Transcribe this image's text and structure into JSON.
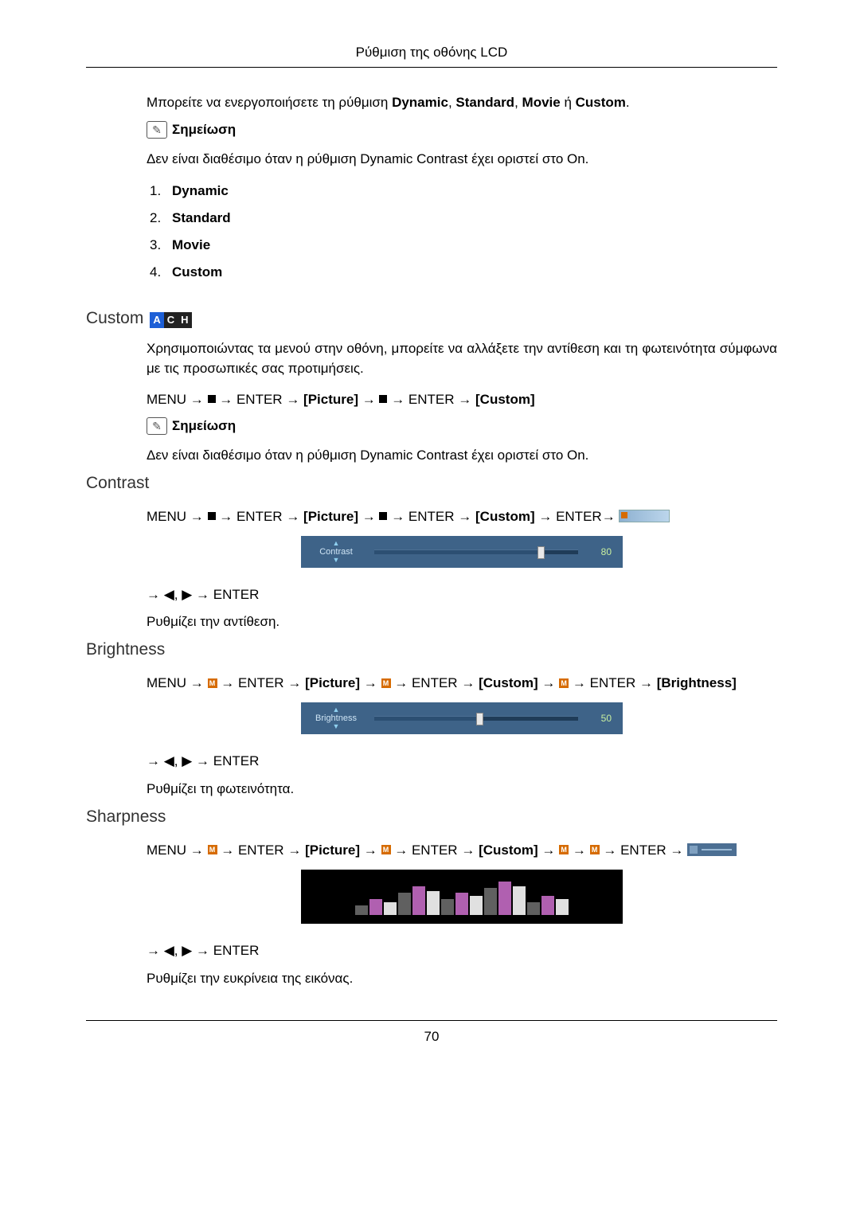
{
  "header": {
    "title": "Ρύθμιση της οθόνης LCD"
  },
  "intro": {
    "line": "Μπορείτε να ενεργοποιήσετε τη ρύθμιση ",
    "m1": "Dynamic",
    "m2": "Standard",
    "m3": "Movie",
    "m4": "Custom",
    "sep": ", ",
    "or": " ή ",
    "end": "."
  },
  "note_label": "Σημείωση",
  "note_body": "Δεν είναι διαθέσιμο όταν η ρύθμιση Dynamic Contrast έχει οριστεί στο On.",
  "modes": [
    {
      "n": "1.",
      "label": "Dynamic"
    },
    {
      "n": "2.",
      "label": "Standard"
    },
    {
      "n": "3.",
      "label": "Movie"
    },
    {
      "n": "4.",
      "label": "Custom"
    }
  ],
  "custom": {
    "heading": "Custom",
    "desc": "Χρησιμοποιώντας τα μενού στην οθόνη, μπορείτε να αλλάξετε την αντίθεση και τη φωτεινότητα σύμφωνα με τις προσωπικές σας προτιμήσεις.",
    "note_body": "Δεν είναι διαθέσιμο όταν η ρύθμιση Dynamic Contrast έχει οριστεί στο On."
  },
  "nav_tokens": {
    "menu": "MENU",
    "arrow": " → ",
    "enter": "ENTER",
    "picture": "[Picture]",
    "custom": "[Custom]",
    "brightness": "[Brightness]"
  },
  "contrast": {
    "heading": "Contrast",
    "slider_label": "Contrast",
    "value": "80",
    "percent": 80,
    "after": "→ ◀, ▶ → ENTER",
    "desc": "Ρυθμίζει την αντίθεση."
  },
  "brightness": {
    "heading": "Brightness",
    "slider_label": "Brightness",
    "value": "50",
    "percent": 50,
    "after": "→ ◀, ▶ → ENTER",
    "desc": "Ρυθμίζει τη φωτεινότητα."
  },
  "sharpness": {
    "heading": "Sharpness",
    "after": "→ ◀, ▶ → ENTER",
    "desc": "Ρυθμίζει την ευκρίνεια της εικόνας."
  },
  "page_number": "70"
}
